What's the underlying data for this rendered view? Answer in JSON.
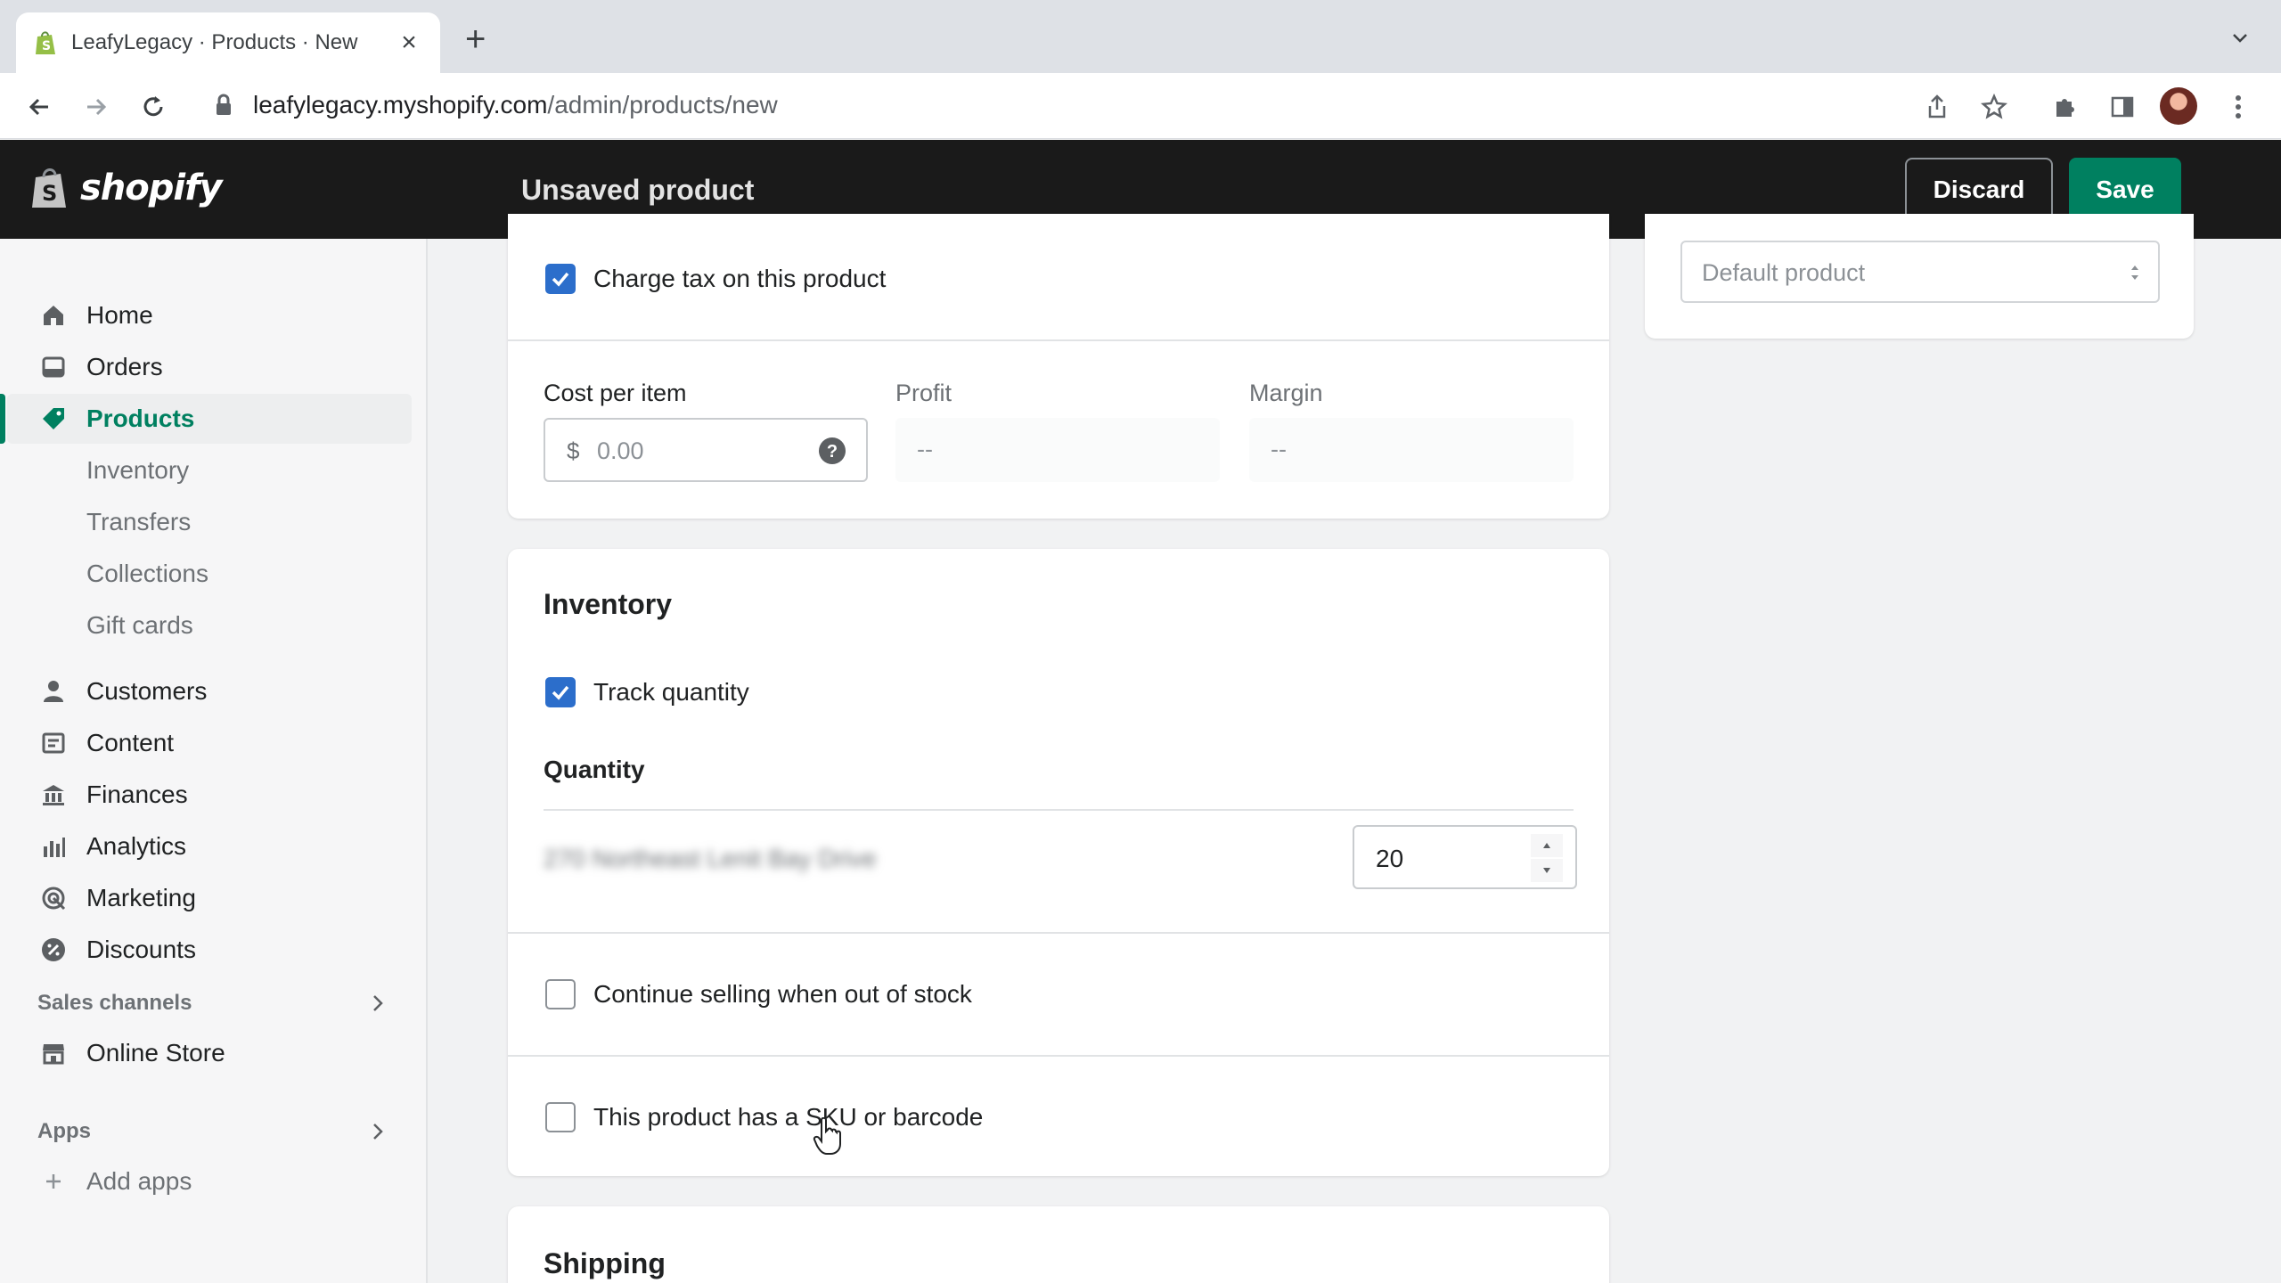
{
  "browser": {
    "tab_title": "LeafyLegacy · Products · New",
    "url_host": "leafylegacy.myshopify.com",
    "url_path": "/admin/products/new"
  },
  "topbar": {
    "logo_text": "shopify",
    "title": "Unsaved product",
    "discard_label": "Discard",
    "save_label": "Save",
    "accent_color": "#008060"
  },
  "sidebar": {
    "items": [
      {
        "label": "Home",
        "icon": "home-icon"
      },
      {
        "label": "Orders",
        "icon": "orders-icon"
      },
      {
        "label": "Products",
        "icon": "tag-icon",
        "active": true
      },
      {
        "label": "Inventory"
      },
      {
        "label": "Transfers"
      },
      {
        "label": "Collections"
      },
      {
        "label": "Gift cards"
      },
      {
        "label": "Customers",
        "icon": "person-icon"
      },
      {
        "label": "Content",
        "icon": "content-icon"
      },
      {
        "label": "Finances",
        "icon": "bank-icon"
      },
      {
        "label": "Analytics",
        "icon": "bar-chart-icon"
      },
      {
        "label": "Marketing",
        "icon": "target-icon"
      },
      {
        "label": "Discounts",
        "icon": "discount-icon"
      }
    ],
    "sales_channels_label": "Sales channels",
    "online_store_label": "Online Store",
    "apps_label": "Apps",
    "add_apps_label": "Add apps"
  },
  "pricing": {
    "charge_tax_label": "Charge tax on this product",
    "charge_tax_checked": true,
    "cost_label": "Cost per item",
    "currency_symbol": "$",
    "cost_placeholder": "0.00",
    "profit_label": "Profit",
    "profit_value": "--",
    "margin_label": "Margin",
    "margin_value": "--"
  },
  "template_select": {
    "value": "Default product"
  },
  "inventory": {
    "title": "Inventory",
    "track_quantity_label": "Track quantity",
    "track_quantity_checked": true,
    "quantity_heading": "Quantity",
    "location_name_blurred": "270 Northeast Lenit Bay Drive",
    "quantity_value": "20",
    "continue_selling_label": "Continue selling when out of stock",
    "continue_selling_checked": false,
    "sku_label": "This product has a SKU or barcode",
    "sku_checked": false
  },
  "shipping": {
    "title": "Shipping"
  }
}
